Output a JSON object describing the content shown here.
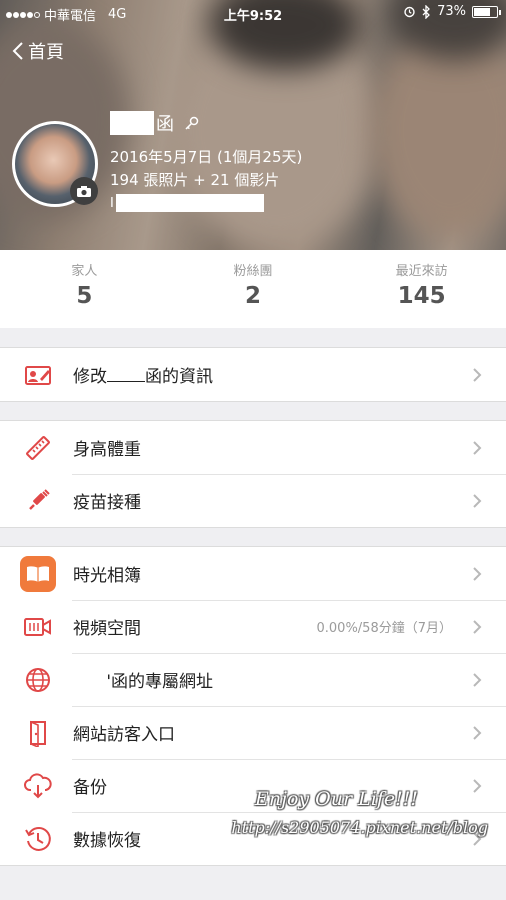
{
  "status_bar": {
    "carrier": "中華電信",
    "network": "4G",
    "time": "上午9:52",
    "battery_percent": "73%",
    "battery_level": 0.73
  },
  "nav": {
    "back_label": "首頁"
  },
  "profile": {
    "name_suffix": "函",
    "birth": "2016年5月7日 (1個月25天)",
    "counts": "194 張照片 + 21 個影片",
    "url_prefix": "I"
  },
  "stats": [
    {
      "label": "家人",
      "value": "5"
    },
    {
      "label": "粉絲團",
      "value": "2"
    },
    {
      "label": "最近來訪",
      "value": "145"
    }
  ],
  "menu": {
    "edit_info": {
      "prefix": "修改",
      "suffix": "函的資訊"
    },
    "height_weight": "身高體重",
    "vaccine": "疫苗接種",
    "album": "時光相簿",
    "video_space": {
      "label": "視頻空間",
      "detail": "0.00%/58分鐘（7月）"
    },
    "site_url": {
      "prefix": "'",
      "suffix": "函的專屬網址"
    },
    "visitor_entry": "網站訪客入口",
    "backup": "备份",
    "restore": "數據恢復"
  },
  "watermark": {
    "line1": "Enjoy Our Life!!!",
    "line2": "http://s2905074.pixnet.net/blog"
  },
  "icons": {
    "accent": "#e04848",
    "album_bg": "#f07a3c"
  }
}
